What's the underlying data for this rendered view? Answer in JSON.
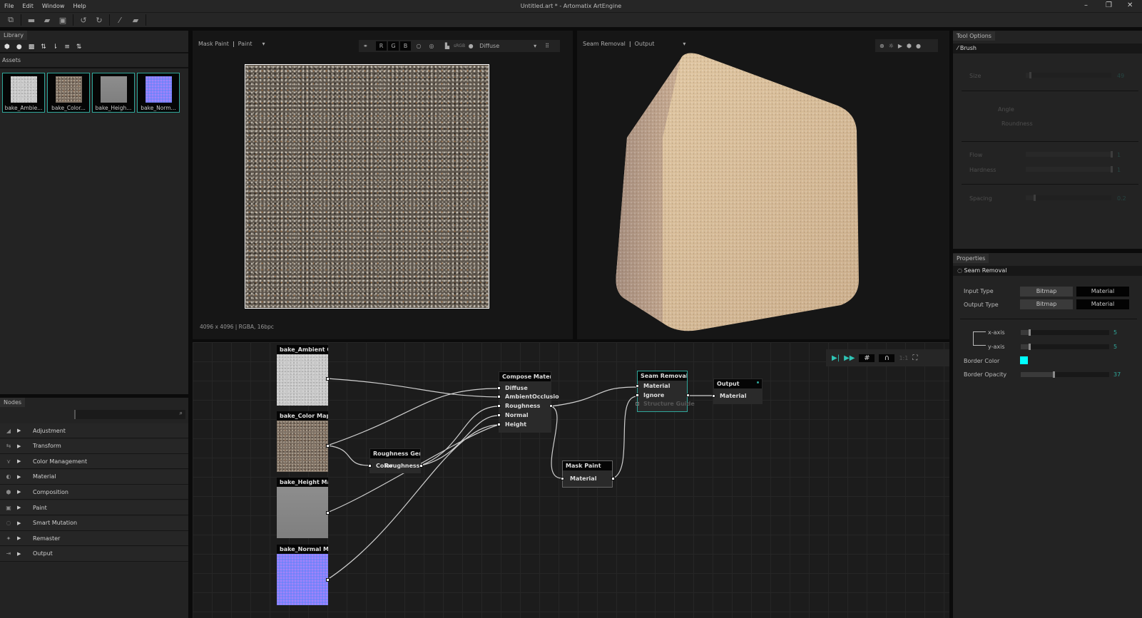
{
  "app": {
    "title": "Untitled.art * - Artomatix ArtEngine",
    "menu": [
      "File",
      "Edit",
      "Window",
      "Help"
    ],
    "window_controls": [
      "minimize-icon",
      "restore-icon",
      "close-icon"
    ]
  },
  "toolbar": {
    "icons": [
      "import-icon",
      "new-icon",
      "open-icon",
      "save-icon",
      "undo-icon",
      "redo-icon",
      "brush-icon",
      "eraser-icon"
    ]
  },
  "library": {
    "tab": "Library",
    "tools": [
      "cube-icon",
      "sphere-icon",
      "checker-icon",
      "sort-az-icon",
      "sort-icon",
      "list-sort-icon",
      "swap-icon"
    ],
    "assets_label": "Assets",
    "assets": [
      {
        "label": "bake_Ambie...",
        "tex": "ao"
      },
      {
        "label": "bake_Color...",
        "tex": "col"
      },
      {
        "label": "bake_Heigh...",
        "tex": "h"
      },
      {
        "label": "bake_Norm...",
        "tex": "n"
      }
    ]
  },
  "nodes_panel": {
    "tab": "Nodes",
    "search_placeholder": "",
    "categories": [
      "Adjustment",
      "Transform",
      "Color Management",
      "Material",
      "Composition",
      "Paint",
      "Smart Mutation",
      "Remaster",
      "Output"
    ]
  },
  "view2d": {
    "node": "Mask Paint",
    "mode": "Paint",
    "channels": [
      "R",
      "G",
      "B"
    ],
    "srgb": "sRGB",
    "channel_select": "Diffuse",
    "info": "4096 x 4096 | RGBA, 16bpc"
  },
  "view3d": {
    "node": "Seam Removal",
    "mode": "Output",
    "icons": [
      "environment-icon",
      "light-icon",
      "camera-icon",
      "cube-icon",
      "sphere-icon"
    ]
  },
  "graph": {
    "zoom": "1:1",
    "nodes": {
      "ao": "bake_Ambient Occ",
      "color": "bake_Color Map fr",
      "height": "bake_Height Map f",
      "normal": "bake_Normal Map",
      "compose": {
        "title": "Compose Material",
        "inputs": [
          "Diffuse",
          "AmbientOcclusio",
          "Roughness",
          "Normal",
          "Height"
        ]
      },
      "rough": {
        "title": "Roughness Genera",
        "input": "Color",
        "output": "Roughness"
      },
      "seam": {
        "title": "Seam Removal",
        "inputs": [
          "Material",
          "Ignore",
          "Structure Guide"
        ]
      },
      "output": {
        "title": "Output",
        "input": "Material"
      },
      "mask": {
        "title": "Mask Paint",
        "input": "Material"
      }
    }
  },
  "tool_options": {
    "tab": "Tool Options",
    "tool": "Brush",
    "size": {
      "label": "Size",
      "value": "49",
      "fraction": 0.05
    },
    "angle": "Angle",
    "roundness": "Roundness",
    "flow": {
      "label": "Flow",
      "value": "1",
      "fraction": 1
    },
    "hardness": {
      "label": "Hardness",
      "value": "1",
      "fraction": 1
    },
    "spacing": {
      "label": "Spacing",
      "value": "0.2",
      "fraction": 0.1
    }
  },
  "properties": {
    "tab": "Properties",
    "node": "Seam Removal",
    "input_type": {
      "label": "Input Type",
      "options": [
        "Bitmap",
        "Material"
      ],
      "selected": "Material"
    },
    "output_type": {
      "label": "Output Type",
      "options": [
        "Bitmap",
        "Material"
      ],
      "selected": "Material"
    },
    "x_axis": {
      "label": "x-axis",
      "value": "5",
      "fraction": 0.1
    },
    "y_axis": {
      "label": "y-axis",
      "value": "5",
      "fraction": 0.1
    },
    "border_color": {
      "label": "Border Color",
      "color": "#00ffff"
    },
    "border_opacity": {
      "label": "Border Opacity",
      "value": "37",
      "fraction": 0.37
    }
  },
  "colors": {
    "accent": "#2fa79a"
  }
}
